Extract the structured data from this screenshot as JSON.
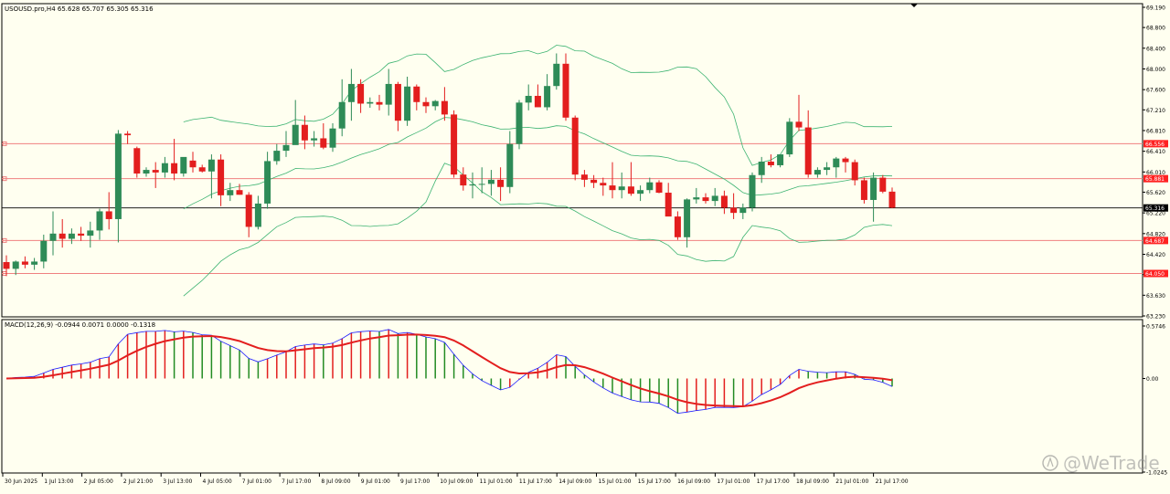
{
  "main_header": "USOUSD.pro,H4  65.628 65.707 65.305 65.316",
  "macd_header": "MACD(12,26,9) -0.0944 0.0071 0.0000 -0.1318",
  "watermark": "@WeTrade",
  "colors": {
    "background": "#fffff0",
    "bull": "#2e8b57",
    "bear": "#e31e1e",
    "bands": "#3cb371",
    "level_line": "#f08080",
    "price_line": "#000000",
    "macd_line": "#1a1aff",
    "signal_line": "#e31e1e",
    "hist_pos": "#e31e1e",
    "hist_neg": "#228b22",
    "tag_red": "#ff2222",
    "tag_black": "#000000"
  },
  "chart_data": [
    {
      "type": "candlestick",
      "title": "USOUSD.pro,H4",
      "ylim": [
        63.23,
        69.19
      ],
      "y_ticks": [
        69.19,
        68.8,
        68.4,
        68.0,
        67.6,
        67.21,
        66.81,
        66.41,
        66.01,
        65.62,
        65.22,
        64.82,
        64.42,
        64.03,
        63.63,
        63.23
      ],
      "y_tick_labels": [
        "69.190",
        "68.800",
        "68.400",
        "68.000",
        "67.600",
        "67.210",
        "66.810",
        "66.410",
        "66.010",
        "65.620",
        "65.220",
        "64.820",
        "64.420",
        "64.030",
        "63.630",
        "63.230"
      ],
      "x_labels": [
        "30 Jun 2025",
        "1 Jul 13:00",
        "2 Jul 05:00",
        "2 Jul 21:00",
        "3 Jul 13:00",
        "4 Jul 05:00",
        "7 Jul 01:00",
        "7 Jul 17:00",
        "8 Jul 09:00",
        "9 Jul 01:00",
        "9 Jul 17:00",
        "10 Jul 09:00",
        "11 Jul 01:00",
        "11 Jul 17:00",
        "14 Jul 09:00",
        "15 Jul 01:00",
        "15 Jul 17:00",
        "16 Jul 09:00",
        "17 Jul 01:00",
        "17 Jul 17:00",
        "18 Jul 09:00",
        "21 Jul 01:00",
        "21 Jul 17:00"
      ],
      "levels": [
        {
          "value": 66.556,
          "label": "66.556"
        },
        {
          "value": 65.881,
          "label": "65.881"
        },
        {
          "value": 64.687,
          "label": "64.687"
        },
        {
          "value": 64.05,
          "label": "64.050"
        }
      ],
      "current_price": {
        "value": 65.316,
        "label": "65.316"
      },
      "ohlc": [
        [
          64.27,
          64.4,
          64.0,
          64.14
        ],
        [
          64.14,
          64.3,
          64.02,
          64.28
        ],
        [
          64.28,
          64.38,
          64.15,
          64.22
        ],
        [
          64.22,
          64.35,
          64.12,
          64.28
        ],
        [
          64.28,
          64.8,
          64.15,
          64.68
        ],
        [
          64.68,
          65.25,
          64.4,
          64.82
        ],
        [
          64.82,
          65.1,
          64.55,
          64.72
        ],
        [
          64.72,
          64.92,
          64.62,
          64.82
        ],
        [
          64.82,
          64.95,
          64.68,
          64.78
        ],
        [
          64.78,
          65.05,
          64.55,
          64.88
        ],
        [
          64.88,
          65.3,
          64.7,
          65.25
        ],
        [
          65.25,
          65.62,
          64.9,
          65.1
        ],
        [
          65.1,
          66.82,
          64.65,
          66.75
        ],
        [
          66.75,
          66.8,
          66.55,
          66.72
        ],
        [
          66.47,
          66.5,
          65.9,
          65.98
        ],
        [
          65.98,
          66.1,
          65.92,
          66.05
        ],
        [
          66.05,
          66.2,
          65.7,
          66.0
        ],
        [
          66.0,
          66.3,
          65.9,
          66.18
        ],
        [
          66.18,
          66.65,
          65.85,
          65.98
        ],
        [
          65.98,
          66.2,
          65.92,
          66.3
        ],
        [
          66.23,
          66.4,
          66.0,
          66.1
        ],
        [
          66.1,
          66.15,
          66.0,
          66.02
        ],
        [
          66.02,
          66.35,
          65.5,
          66.25
        ],
        [
          66.25,
          66.35,
          65.35,
          65.56
        ],
        [
          65.56,
          65.8,
          65.45,
          65.66
        ],
        [
          65.66,
          65.78,
          65.57,
          65.57
        ],
        [
          65.57,
          65.62,
          64.75,
          64.95
        ],
        [
          64.95,
          65.55,
          64.9,
          65.4
        ],
        [
          65.4,
          66.4,
          65.3,
          66.22
        ],
        [
          66.22,
          66.55,
          66.15,
          66.42
        ],
        [
          66.42,
          66.8,
          66.3,
          66.53
        ],
        [
          66.53,
          67.4,
          66.6,
          66.92
        ],
        [
          66.92,
          67.1,
          66.45,
          66.62
        ],
        [
          66.62,
          66.8,
          66.5,
          66.66
        ],
        [
          66.66,
          66.95,
          66.45,
          66.48
        ],
        [
          66.48,
          66.95,
          66.4,
          66.85
        ],
        [
          66.85,
          67.8,
          66.7,
          67.36
        ],
        [
          67.36,
          68.0,
          67.0,
          67.71
        ],
        [
          67.71,
          67.8,
          67.15,
          67.33
        ],
        [
          67.33,
          67.45,
          67.25,
          67.36
        ],
        [
          67.36,
          67.5,
          67.2,
          67.31
        ],
        [
          67.31,
          68.0,
          67.1,
          67.71
        ],
        [
          67.71,
          67.75,
          66.8,
          67.0
        ],
        [
          67.0,
          67.85,
          66.9,
          67.66
        ],
        [
          67.66,
          67.7,
          67.2,
          67.36
        ],
        [
          67.36,
          67.45,
          67.15,
          67.28
        ],
        [
          67.28,
          67.4,
          67.2,
          67.38
        ],
        [
          67.38,
          67.65,
          67.0,
          67.12
        ],
        [
          67.12,
          67.2,
          65.9,
          65.96
        ],
        [
          65.96,
          66.1,
          65.65,
          65.75
        ],
        [
          65.75,
          66.0,
          65.5,
          65.77
        ],
        [
          65.77,
          66.1,
          65.6,
          65.78
        ],
        [
          65.78,
          66.05,
          65.55,
          65.86
        ],
        [
          65.86,
          66.1,
          65.45,
          65.72
        ],
        [
          65.72,
          66.8,
          65.6,
          66.55
        ],
        [
          66.55,
          67.4,
          66.45,
          67.35
        ],
        [
          67.35,
          67.7,
          67.2,
          67.48
        ],
        [
          67.48,
          67.7,
          67.3,
          67.26
        ],
        [
          67.26,
          67.9,
          67.2,
          67.67
        ],
        [
          67.67,
          68.3,
          67.6,
          68.1
        ],
        [
          68.1,
          68.3,
          67.0,
          67.06
        ],
        [
          67.06,
          67.1,
          65.85,
          65.96
        ],
        [
          65.96,
          66.05,
          65.72,
          65.86
        ],
        [
          65.86,
          65.95,
          65.7,
          65.8
        ],
        [
          65.8,
          65.9,
          65.55,
          65.75
        ],
        [
          65.75,
          66.2,
          65.5,
          65.66
        ],
        [
          65.66,
          66.0,
          65.5,
          65.73
        ],
        [
          65.73,
          66.2,
          65.55,
          65.59
        ],
        [
          65.59,
          65.75,
          65.45,
          65.66
        ],
        [
          65.66,
          65.9,
          65.6,
          65.81
        ],
        [
          65.81,
          65.85,
          65.6,
          65.61
        ],
        [
          65.61,
          65.8,
          65.4,
          65.15
        ],
        [
          65.15,
          65.25,
          64.7,
          64.75
        ],
        [
          64.75,
          65.5,
          64.55,
          65.48
        ],
        [
          65.48,
          65.7,
          65.4,
          65.52
        ],
        [
          65.52,
          65.6,
          65.4,
          65.45
        ],
        [
          65.45,
          65.7,
          65.35,
          65.55
        ],
        [
          65.55,
          65.65,
          65.2,
          65.32
        ],
        [
          65.32,
          65.6,
          65.1,
          65.22
        ],
        [
          65.22,
          65.4,
          65.1,
          65.32
        ],
        [
          65.32,
          66.0,
          65.25,
          65.95
        ],
        [
          65.95,
          66.3,
          65.8,
          66.21
        ],
        [
          66.21,
          66.35,
          66.1,
          66.14
        ],
        [
          66.14,
          66.3,
          66.1,
          66.35
        ],
        [
          66.35,
          67.05,
          66.3,
          66.98
        ],
        [
          66.98,
          67.5,
          66.8,
          66.87
        ],
        [
          66.87,
          67.2,
          65.9,
          65.96
        ],
        [
          65.96,
          66.1,
          65.9,
          66.05
        ],
        [
          66.05,
          66.2,
          65.95,
          66.1
        ],
        [
          66.1,
          66.3,
          65.9,
          66.27
        ],
        [
          66.27,
          66.3,
          66.0,
          66.2
        ],
        [
          66.2,
          66.25,
          65.75,
          65.85
        ],
        [
          65.85,
          65.9,
          65.4,
          65.47
        ],
        [
          65.47,
          66.0,
          65.05,
          65.9
        ],
        [
          65.9,
          65.95,
          65.6,
          65.63
        ],
        [
          65.63,
          65.71,
          65.31,
          65.32
        ]
      ]
    },
    {
      "type": "macd",
      "title": "MACD(12,26,9)",
      "ylim": [
        -1.0245,
        0.5746
      ],
      "y_tick_labels": [
        "0.5746",
        "0.00",
        "-1.0245"
      ],
      "y_ticks": [
        0.5746,
        0.0,
        -1.0245
      ],
      "values_line_end": -0.0944,
      "signal_line_end": 0.0071
    }
  ]
}
